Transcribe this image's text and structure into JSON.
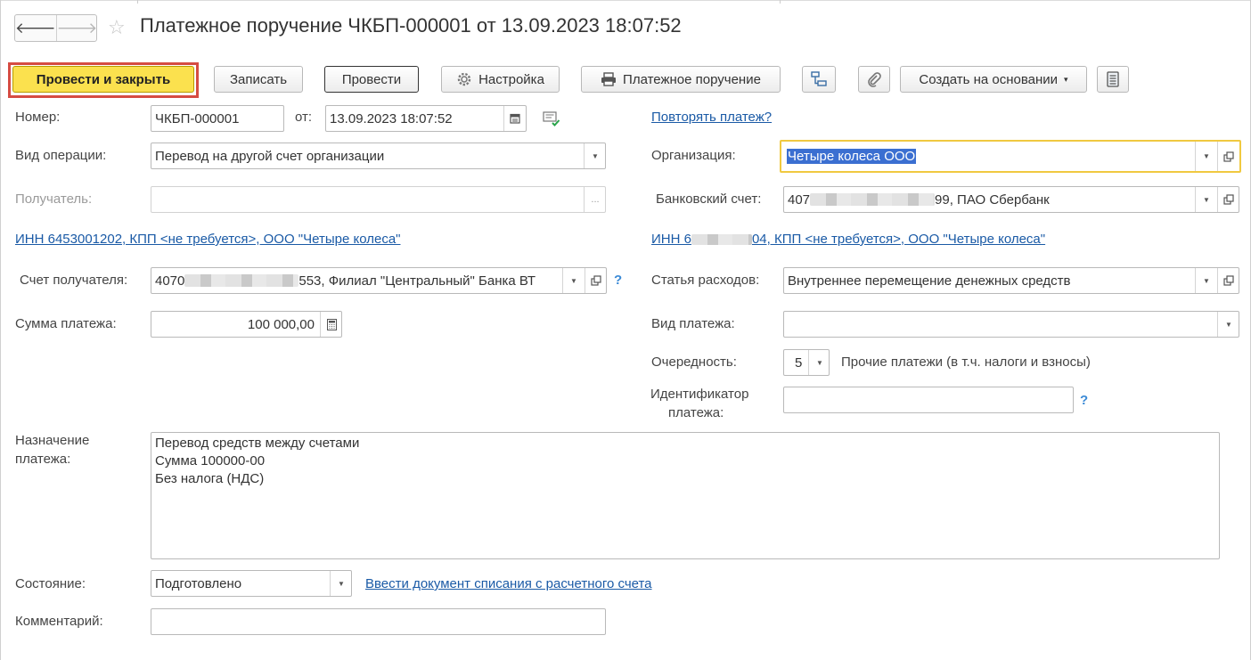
{
  "window": {
    "title": "Платежное поручение ЧКБП-000001 от 13.09.2023 18:07:52"
  },
  "nav": {
    "back_icon": "arrow-left-icon",
    "forward_icon": "arrow-right-icon",
    "favorite_icon": "star-icon"
  },
  "toolbar": {
    "post_close": "Провести и закрыть",
    "save": "Записать",
    "post": "Провести",
    "settings": "Настройка",
    "print_order": "Платежное поручение",
    "create_based": "Создать на основании",
    "create_based_arrow": "▾",
    "colors": {
      "primary": "#fbe14e",
      "highlight_frame": "#d64c42"
    }
  },
  "form": {
    "number_label": "Номер:",
    "number_value": "ЧКБП-000001",
    "date_label": "от:",
    "date_value": "13.09.2023 18:07:52",
    "repeat_link": "Повторять платеж?",
    "operation_label": "Вид операции:",
    "operation_value": "Перевод на другой счет организации",
    "org_label": "Организация:",
    "org_value": "Четыре колеса ООО",
    "recipient_label": "Получатель:",
    "recipient_more": "...",
    "bank_account_label": "Банковский счет:",
    "bank_account_prefix": "407",
    "bank_account_suffix": "99, ПАО Сбербанк",
    "inn_link_left": "ИНН 6453001202, КПП <не требуется>, ООО \"Четыре колеса\"",
    "inn_link_right_prefix": "ИНН 6",
    "inn_link_right_suffix": "04, КПП <не требуется>, ООО \"Четыре колеса\"",
    "recipient_account_label": "Счет получателя:",
    "recipient_account_prefix": "4070",
    "recipient_account_suffix": "553, Филиал \"Центральный\" Банка ВТ",
    "expense_label": "Статья расходов:",
    "expense_value": "Внутреннее перемещение денежных средств",
    "amount_label": "Сумма платежа:",
    "amount_value": "100 000,00",
    "payment_type_label": "Вид платежа:",
    "payment_type_value": "",
    "priority_label": "Очередность:",
    "priority_value": "5",
    "priority_desc": "Прочие платежи (в т.ч. налоги и взносы)",
    "payment_id_label_1": "Идентификатор",
    "payment_id_label_2": "платежа:",
    "payment_id_value": "",
    "purpose_label_1": "Назначение",
    "purpose_label_2": "платежа:",
    "purpose_lines": [
      "Перевод средств между счетами",
      "Сумма 100000-00",
      "Без налога (НДС)"
    ],
    "state_label": "Состояние:",
    "state_value": "Подготовлено",
    "write_off_link": "Ввести документ списания с расчетного счета",
    "comment_label": "Комментарий:",
    "comment_value": "",
    "help_mark": "?"
  }
}
